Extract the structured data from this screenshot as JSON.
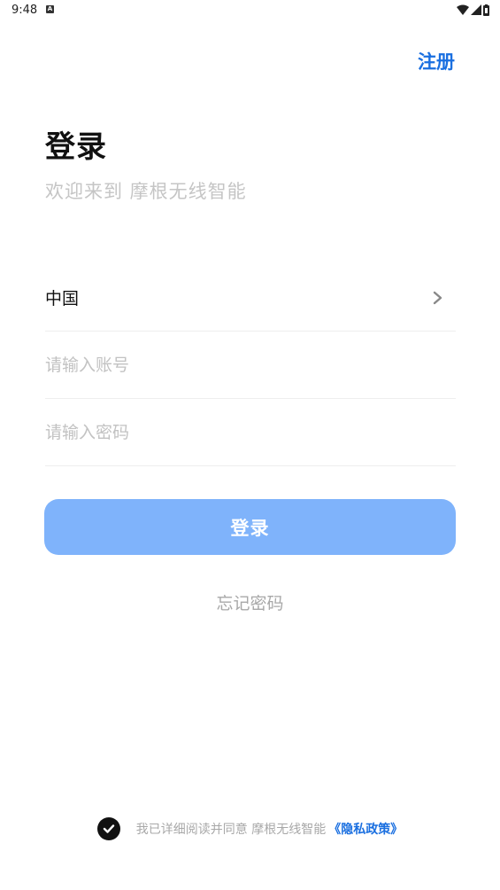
{
  "status_bar": {
    "time": "9:48",
    "notification_icon": "notification-icon"
  },
  "header": {
    "register_label": "注册"
  },
  "title": "登录",
  "welcome": "欢迎来到 摩根无线智能",
  "form": {
    "region_label": "中国",
    "account_placeholder": "请输入账号",
    "password_placeholder": "请输入密码"
  },
  "login_button_label": "登录",
  "forgot_password_label": "忘记密码",
  "agreement": {
    "text": "我已详细阅读并同意 摩根无线智能",
    "privacy_link": "《隐私政策》"
  },
  "colors": {
    "accent": "#1a6fe0",
    "button": "#7fb3fb",
    "placeholder": "#c2c2c2"
  }
}
